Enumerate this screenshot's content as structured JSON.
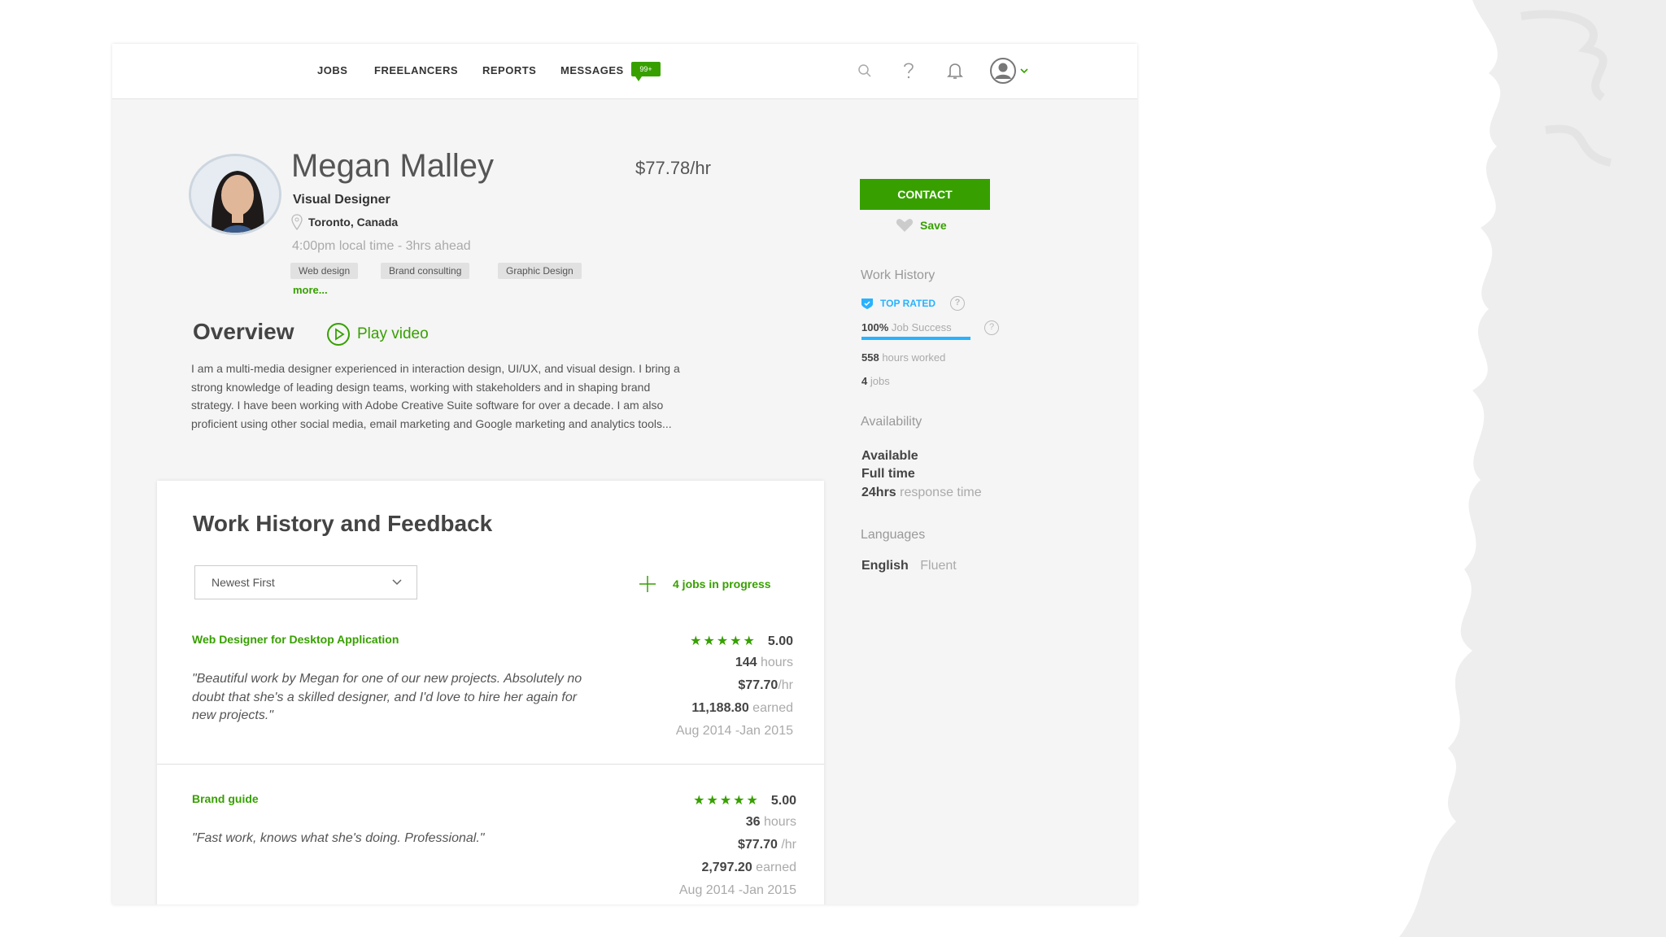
{
  "nav": {
    "jobs": "JOBS",
    "freelancers": "FREELANCERS",
    "reports": "REPORTS",
    "messages": "MESSAGES",
    "messages_badge": "99+"
  },
  "profile": {
    "name": "Megan Malley",
    "rate": "$77.78/hr",
    "title": "Visual Designer",
    "location": "Toronto, Canada",
    "local_time": "4:00pm local time - 3hrs ahead",
    "tags": [
      "Web design",
      "Brand consulting",
      "Graphic Design"
    ],
    "more": "more..."
  },
  "overview": {
    "title": "Overview",
    "play_video": "Play video",
    "text": "I am a multi-media designer experienced in interaction design, UI/UX, and visual design. I bring a strong knowledge of leading design teams, working with stakeholders and in shaping brand strategy. I have been working with Adobe Creative Suite software for over a decade. I am also proficient using other social media, email marketing and Google marketing and analytics tools..."
  },
  "work_history": {
    "title": "Work History and Feedback",
    "sort_value": "Newest First",
    "jobs_in_progress": "4 jobs in progress",
    "jobs": [
      {
        "title": "Web Designer for Desktop Application",
        "quote": "\"Beautiful work by Megan for one of our new projects. Absolutely no doubt that she's a skilled designer, and I'd love to hire her again for new projects.\"",
        "stars": "★★★★★",
        "rating": "5.00",
        "hours": "144",
        "hours_label": "hours",
        "rate": "$77.70",
        "rate_label": "/hr",
        "earned": "11,188.80",
        "earned_label": "earned",
        "dates": "Aug 2014 -Jan 2015"
      },
      {
        "title": "Brand guide",
        "quote": "\"Fast work, knows what she's doing. Professional.\"",
        "stars": "★★★★★",
        "rating": "5.00",
        "hours": "36",
        "hours_label": "hours",
        "rate": "$77.70",
        "rate_label": "/hr",
        "earned": "2,797.20",
        "earned_label": "earned",
        "dates": "Aug 2014 -Jan 2015"
      }
    ]
  },
  "sidebar": {
    "contact": "CONTACT",
    "save": "Save",
    "work_history_heading": "Work History",
    "top_rated": "TOP RATED",
    "job_success_value": "100%",
    "job_success_label": "Job Success",
    "job_success_fraction": 1.0,
    "hours_worked_value": "558",
    "hours_worked_label": "hours worked",
    "jobs_value": "4",
    "jobs_label": "jobs",
    "availability_heading": "Availability",
    "availability": "Available",
    "schedule": "Full time",
    "response_value": "24hrs",
    "response_label": "response time",
    "languages_heading": "Languages",
    "language": "English",
    "language_level": "Fluent"
  },
  "colors": {
    "accent_green": "#37a000",
    "top_rated_blue": "#29b2fe"
  }
}
